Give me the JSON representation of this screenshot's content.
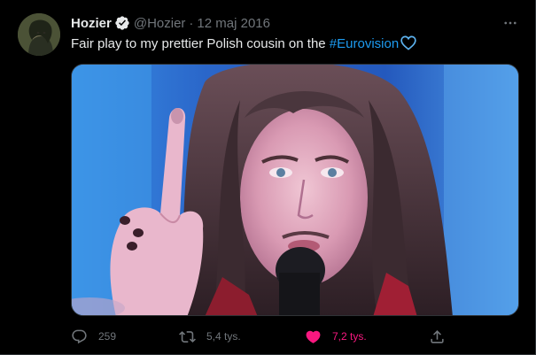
{
  "tweet": {
    "author_name": "Hozier",
    "handle": "@Hozier",
    "separator": "·",
    "date": "12 maj 2016",
    "text_before": "Fair play to my prettier Polish cousin on the ",
    "hashtag": "#Eurovision",
    "emoji": "blue-heart-icon",
    "verified": true
  },
  "actions": {
    "reply_count": "259",
    "retweet_count": "5,4 tys.",
    "like_count": "7,2 tys.",
    "liked": true
  },
  "colors": {
    "background": "#000000",
    "text_primary": "#e7e9ea",
    "text_secondary": "#71767b",
    "accent_blue": "#1d9bf0",
    "like_pink": "#f91880"
  },
  "icons": {
    "more": "more-icon",
    "reply": "reply-icon",
    "retweet": "retweet-icon",
    "like": "heart-filled-icon",
    "share": "share-icon",
    "verified": "verified-badge-icon"
  }
}
